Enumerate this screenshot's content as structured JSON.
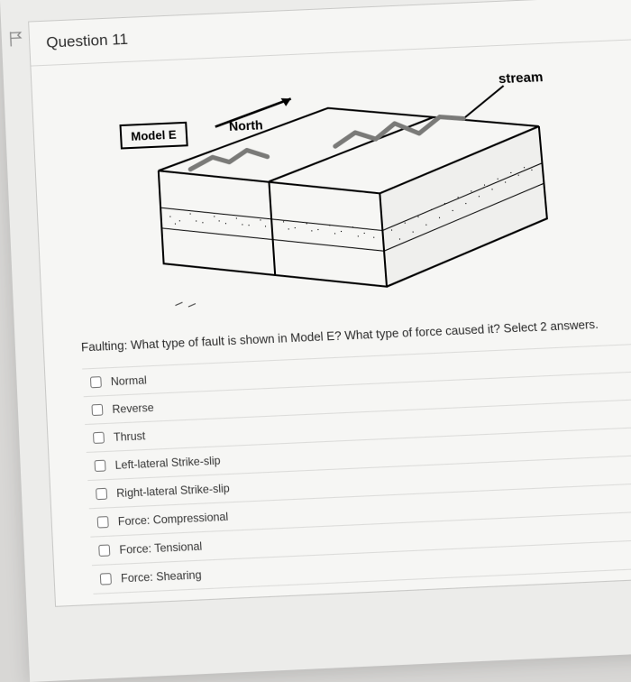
{
  "question": {
    "number_label": "Question 11",
    "prompt": "Faulting: What type of fault is shown in Model E? What type of force caused it? Select 2 answers."
  },
  "diagram": {
    "model_label": "Model E",
    "north_label": "North",
    "stream_label": "stream"
  },
  "options": [
    {
      "label": "Normal"
    },
    {
      "label": "Reverse"
    },
    {
      "label": "Thrust"
    },
    {
      "label": "Left-lateral Strike-slip"
    },
    {
      "label": "Right-lateral Strike-slip"
    },
    {
      "label": "Force: Compressional"
    },
    {
      "label": "Force: Tensional"
    },
    {
      "label": "Force: Shearing"
    }
  ]
}
